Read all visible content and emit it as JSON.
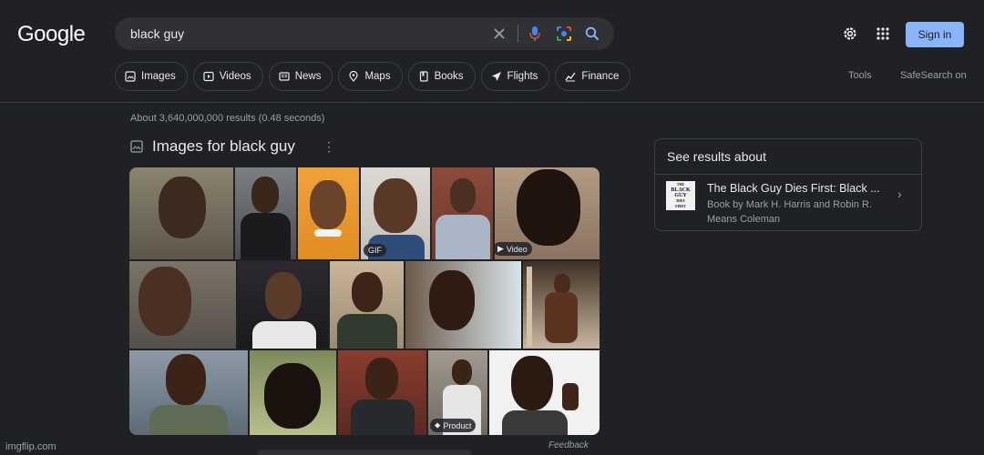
{
  "header": {
    "logo": "Google",
    "search_query": "black guy",
    "sign_in_label": "Sign in"
  },
  "chips": [
    {
      "label": "Images",
      "icon": "image-icon"
    },
    {
      "label": "Videos",
      "icon": "video-icon"
    },
    {
      "label": "News",
      "icon": "news-icon"
    },
    {
      "label": "Maps",
      "icon": "map-pin-icon"
    },
    {
      "label": "Books",
      "icon": "book-icon"
    },
    {
      "label": "Flights",
      "icon": "plane-icon"
    },
    {
      "label": "Finance",
      "icon": "finance-icon"
    }
  ],
  "tools_label": "Tools",
  "safesearch_label": "SafeSearch on",
  "results_stats": "About 3,640,000,000 results (0.48 seconds)",
  "images_section": {
    "title": "Images for black guy",
    "badges": {
      "gif": "GIF",
      "video": "Video",
      "product": "Product"
    }
  },
  "side_panel": {
    "heading": "See results about",
    "book_cover_text": [
      "THE",
      "BLACK",
      "GUY",
      "DIES",
      "FIRST"
    ],
    "result_title": "The Black Guy Dies First: Black ...",
    "result_subtitle": "Book by Mark H. Harris and Robin R. Means Coleman"
  },
  "feedback_label": "Feedback",
  "watermark": "imgflip.com",
  "colors": {
    "background": "#202124",
    "accent": "#8ab4f8",
    "text": "#e8eaed",
    "muted": "#9aa0a6"
  }
}
